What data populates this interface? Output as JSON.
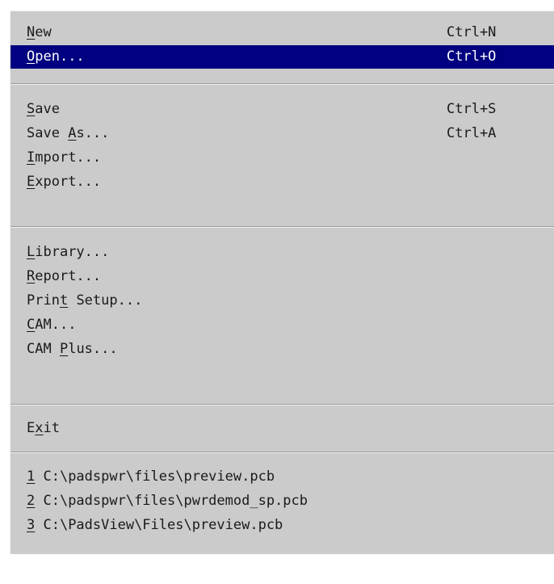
{
  "menu": {
    "items": [
      {
        "pre": "",
        "mn": "N",
        "post": "ew",
        "shortcut": "Ctrl+N"
      },
      {
        "pre": "",
        "mn": "O",
        "post": "pen...",
        "shortcut": "Ctrl+O"
      },
      {
        "pre": "",
        "mn": "S",
        "post": "ave",
        "shortcut": "Ctrl+S"
      },
      {
        "pre": "Save ",
        "mn": "A",
        "post": "s...",
        "shortcut": "Ctrl+A"
      },
      {
        "pre": "",
        "mn": "I",
        "post": "mport..."
      },
      {
        "pre": "",
        "mn": "E",
        "post": "xport..."
      },
      {
        "pre": "",
        "mn": "L",
        "post": "ibrary..."
      },
      {
        "pre": "",
        "mn": "R",
        "post": "eport..."
      },
      {
        "pre": "Prin",
        "mn": "t",
        "post": " Setup..."
      },
      {
        "pre": "",
        "mn": "C",
        "post": "AM..."
      },
      {
        "pre": "CAM ",
        "mn": "P",
        "post": "lus..."
      },
      {
        "pre": "E",
        "mn": "x",
        "post": "it"
      },
      {
        "pre": "",
        "mn": "1",
        "post": " C:\\padspwr\\files\\preview.pcb"
      },
      {
        "pre": "",
        "mn": "2",
        "post": " C:\\padspwr\\files\\pwrdemod_sp.pcb"
      },
      {
        "pre": "",
        "mn": "3",
        "post": " C:\\PadsView\\Files\\preview.pcb"
      }
    ],
    "highlighted_index": 1
  }
}
